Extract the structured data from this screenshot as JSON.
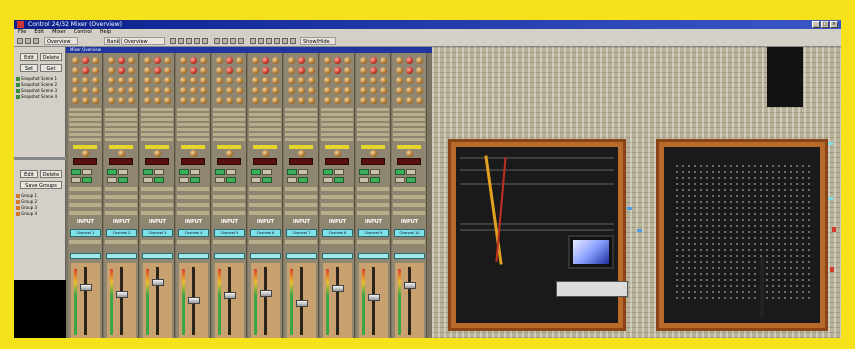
{
  "window": {
    "title": "Control 24/32 Mixer (Overview)"
  },
  "menu": [
    "File",
    "Edit",
    "Mixer",
    "Control",
    "Help"
  ],
  "toolbar": {
    "scene_label": "Overview",
    "layer_label": "Bank",
    "mode_label": "Overview",
    "right_label": "Show/Hide"
  },
  "left_panel": {
    "buttons": [
      "Edit",
      "Delete",
      "Set",
      "Get",
      "Edit",
      "Delete",
      "Save Groups"
    ],
    "scenes": [
      "Snapshot Scene 1",
      "Snapshot Scene 2",
      "Snapshot Scene 3",
      "Snapshot Scene 4"
    ],
    "groups": [
      "Group 1",
      "Group 2",
      "Group 3",
      "Group 4"
    ]
  },
  "mixer": {
    "title": "Mixer Overview",
    "channels": [
      {
        "input": "INPUT",
        "name": "Channel 1",
        "fader": 0.72
      },
      {
        "input": "INPUT",
        "name": "Channel 2",
        "fader": 0.6
      },
      {
        "input": "INPUT",
        "name": "Channel 3",
        "fader": 0.8
      },
      {
        "input": "INPUT",
        "name": "Channel 4",
        "fader": 0.5
      },
      {
        "input": "INPUT",
        "name": "Channel 5",
        "fader": 0.58
      },
      {
        "input": "INPUT",
        "name": "Channel 6",
        "fader": 0.62
      },
      {
        "input": "INPUT",
        "name": "Channel 7",
        "fader": 0.45
      },
      {
        "input": "INPUT",
        "name": "Channel 8",
        "fader": 0.7
      },
      {
        "input": "INPUT",
        "name": "Channel 9",
        "fader": 0.55
      },
      {
        "input": "INPUT",
        "name": "Channel 10",
        "fader": 0.75
      }
    ]
  },
  "colors": {
    "frame": "#f6e21a",
    "titlebar": "#0a1f8a",
    "case": "#b86a2a",
    "channel_name": "#7fe0e6"
  },
  "icons": [
    "app-icon",
    "minimize-icon",
    "maximize-icon",
    "close-icon"
  ]
}
